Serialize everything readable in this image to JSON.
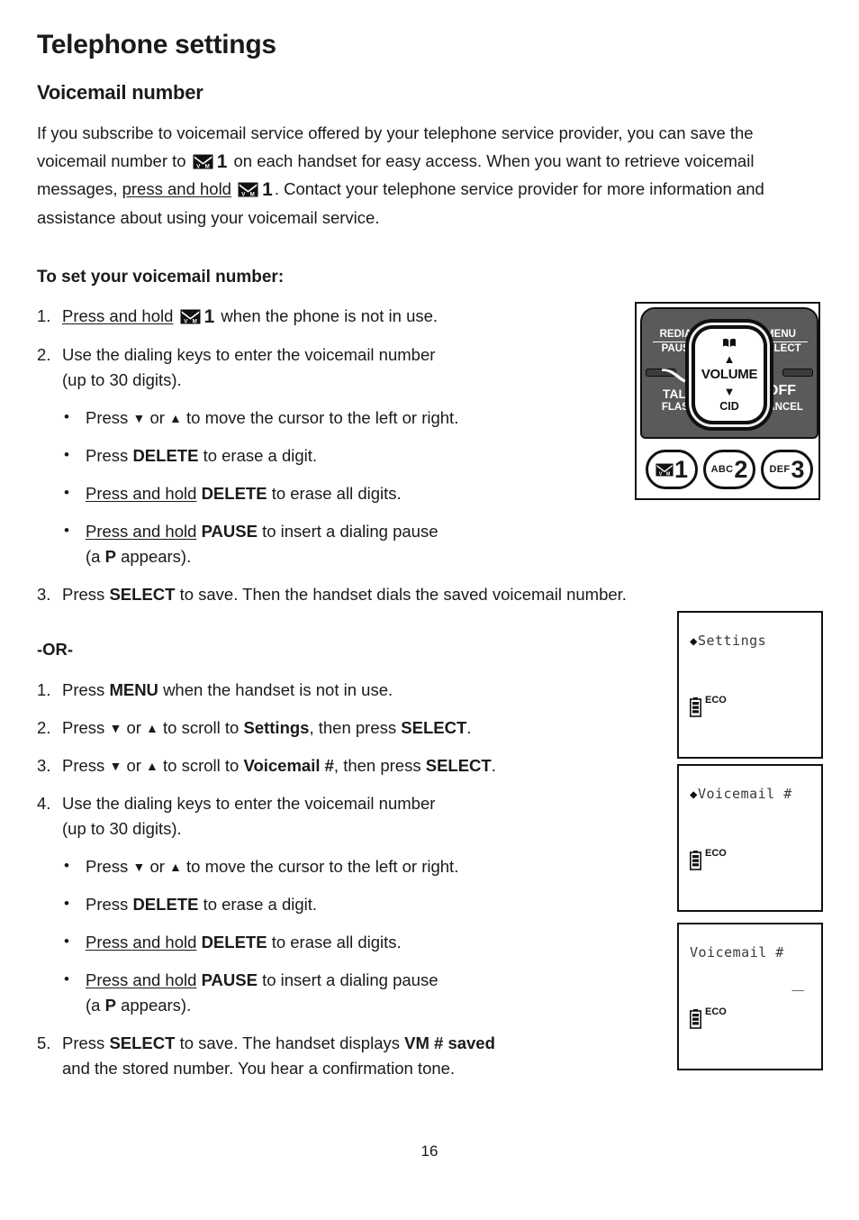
{
  "document": {
    "chapter_title": "Telephone settings",
    "section_title": "Voicemail number",
    "page_number": "16"
  },
  "intro": {
    "l1": "If you subscribe to voicemail service offered by your telephone service provider,",
    "l2a": "you can save the voicemail number to",
    "l2b": "1",
    "l2c": "on each handset for easy access.",
    "l3a": "When you want to retrieve voicemail messages,",
    "l3b": "press and hold",
    "l3c": "1",
    "l3d": ". Contact your",
    "l4": "telephone service provider for more information and assistance about using your",
    "l5": "voicemail service."
  },
  "subhead": "To set your voicemail number:",
  "procedure_a": {
    "steps": [
      {
        "num": "1.",
        "pre_underline": "Press and hold",
        "key": "1",
        "post": "when the phone is not in use."
      },
      {
        "num": "2.",
        "line1": "Use the dialing keys to enter the voicemail number",
        "line2": "(up to 30 digits)."
      },
      {
        "num": "3.",
        "pre": "Press",
        "bold": "SELECT",
        "post": "to save. Then the handset dials the saved voicemail number."
      }
    ],
    "bullets": [
      {
        "pre": "Press",
        "down": "▼",
        "mid": "or",
        "up": "▲",
        "post": "to move the cursor to the left or right."
      },
      {
        "pre": "Press",
        "bold": "DELETE",
        "post": "to erase a digit."
      },
      {
        "underline": "Press and hold",
        "bold": "DELETE",
        "post": "to erase all digits."
      },
      {
        "underline": "Press and hold",
        "bold": "PAUSE",
        "post": "to insert a dialing pause",
        "line2_pre": "(a",
        "line2_bold": "P",
        "line2_post": "appears)."
      }
    ]
  },
  "or_label": "-OR-",
  "procedure_b": {
    "steps": [
      {
        "num": "1.",
        "pre": "Press",
        "bold": "MENU",
        "post": "when the handset is not in use."
      },
      {
        "num": "2.",
        "pre": "Press",
        "down": "▼",
        "mid": "or",
        "up": "▲",
        "post": "to scroll to",
        "bold": "Settings",
        "tail": ", then press",
        "bold2": "SELECT",
        "end": "."
      },
      {
        "num": "3.",
        "pre": "Press",
        "down": "▼",
        "mid": "or",
        "up": "▲",
        "post": "to scroll to",
        "bold": "Voicemail #",
        "tail": ", then press",
        "bold2": "SELECT",
        "end": "."
      },
      {
        "num": "4.",
        "line1": "Use the dialing keys to enter the voicemail number",
        "line2": "(up to 30 digits)."
      },
      {
        "num": "5.",
        "pre": "Press",
        "bold": "SELECT",
        "post": "to save. The handset displays",
        "bold2": "VM # saved",
        "line2": "and the stored number. You hear a confirmation tone."
      }
    ],
    "bullets": [
      {
        "pre": "Press",
        "down": "▼",
        "mid": "or",
        "up": "▲",
        "post": "to move the cursor to the left or right."
      },
      {
        "pre": "Press",
        "bold": "DELETE",
        "post": "to erase a digit."
      },
      {
        "underline": "Press and hold",
        "bold": "DELETE",
        "post": "to erase all digits."
      },
      {
        "underline": "Press and hold",
        "bold": "PAUSE",
        "post": "to insert a dialing pause",
        "line2_pre": "(a",
        "line2_bold": "P",
        "line2_post": "appears)."
      }
    ]
  },
  "keypad_diagram": {
    "redial": "REDIAL",
    "pause": "PAUSE",
    "menu": "MENU",
    "select": "SELECT",
    "talk": "TALK",
    "flash": "FLASH",
    "off": "OFF",
    "cancel": "CANCEL",
    "volume": "VOLUME",
    "cid": "CID",
    "up_arrow": "▲",
    "down_arrow": "▼",
    "directory_icon": "phonebook-icon",
    "handset_icon": "handset-icon",
    "keys": [
      {
        "letters": "",
        "digit": "1",
        "icon": "voicemail-envelope-icon"
      },
      {
        "letters": "ABC",
        "digit": "2",
        "icon": ""
      },
      {
        "letters": "DEF",
        "digit": "3",
        "icon": ""
      }
    ],
    "body_color": "#5a5a5a"
  },
  "lcd_screens": [
    {
      "id": "lcd-settings",
      "diamond": "◆",
      "title": "Settings",
      "dashes": "",
      "eco": "ECO"
    },
    {
      "id": "lcd-voicemail-menu",
      "diamond": "◆",
      "title": "Voicemail #",
      "dashes": "",
      "eco": "ECO"
    },
    {
      "id": "lcd-voicemail-entry",
      "diamond": "",
      "title": "Voicemail #",
      "dashes": "––",
      "eco": "ECO"
    }
  ]
}
